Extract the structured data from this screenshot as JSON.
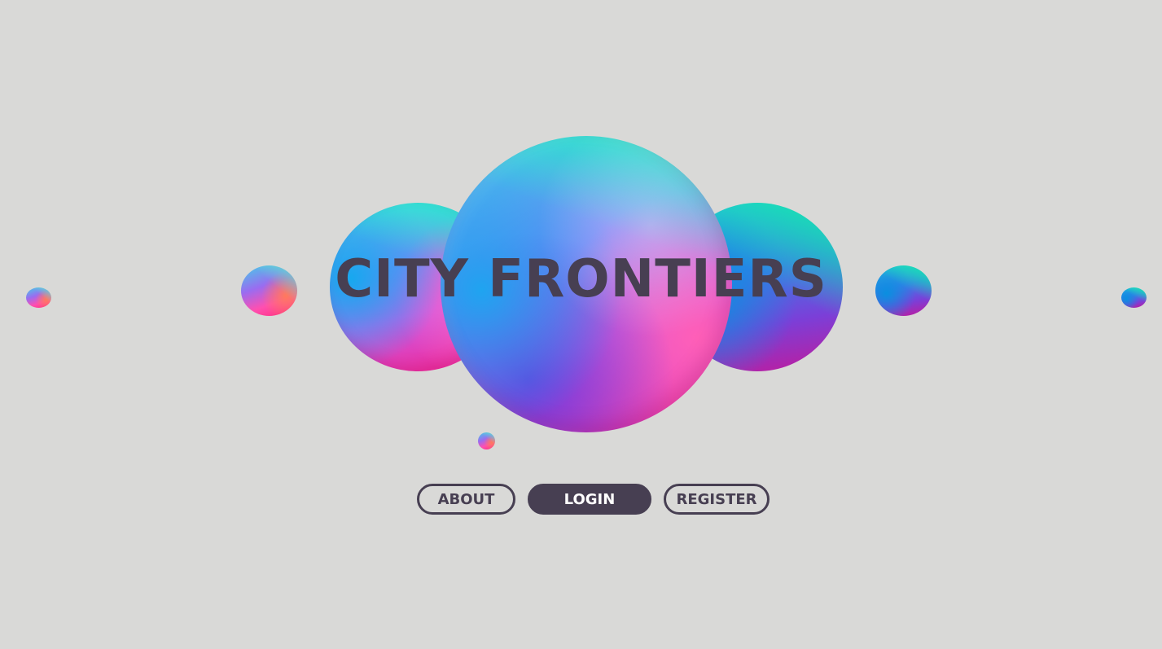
{
  "hero": {
    "title": "CITY FRONTIERS"
  },
  "nav": {
    "about_label": "ABOUT",
    "login_label": "LOGIN",
    "register_label": "REGISTER"
  },
  "colors": {
    "background": "#d9d9d7",
    "text": "#473f52",
    "button_active_bg": "#473f52",
    "button_active_text": "#ffffff",
    "sphere_teal": "#1ef5be",
    "sphere_blue": "#1fa4f0",
    "sphere_purple": "#7b5ff0",
    "sphere_pink": "#ff1f8f"
  }
}
